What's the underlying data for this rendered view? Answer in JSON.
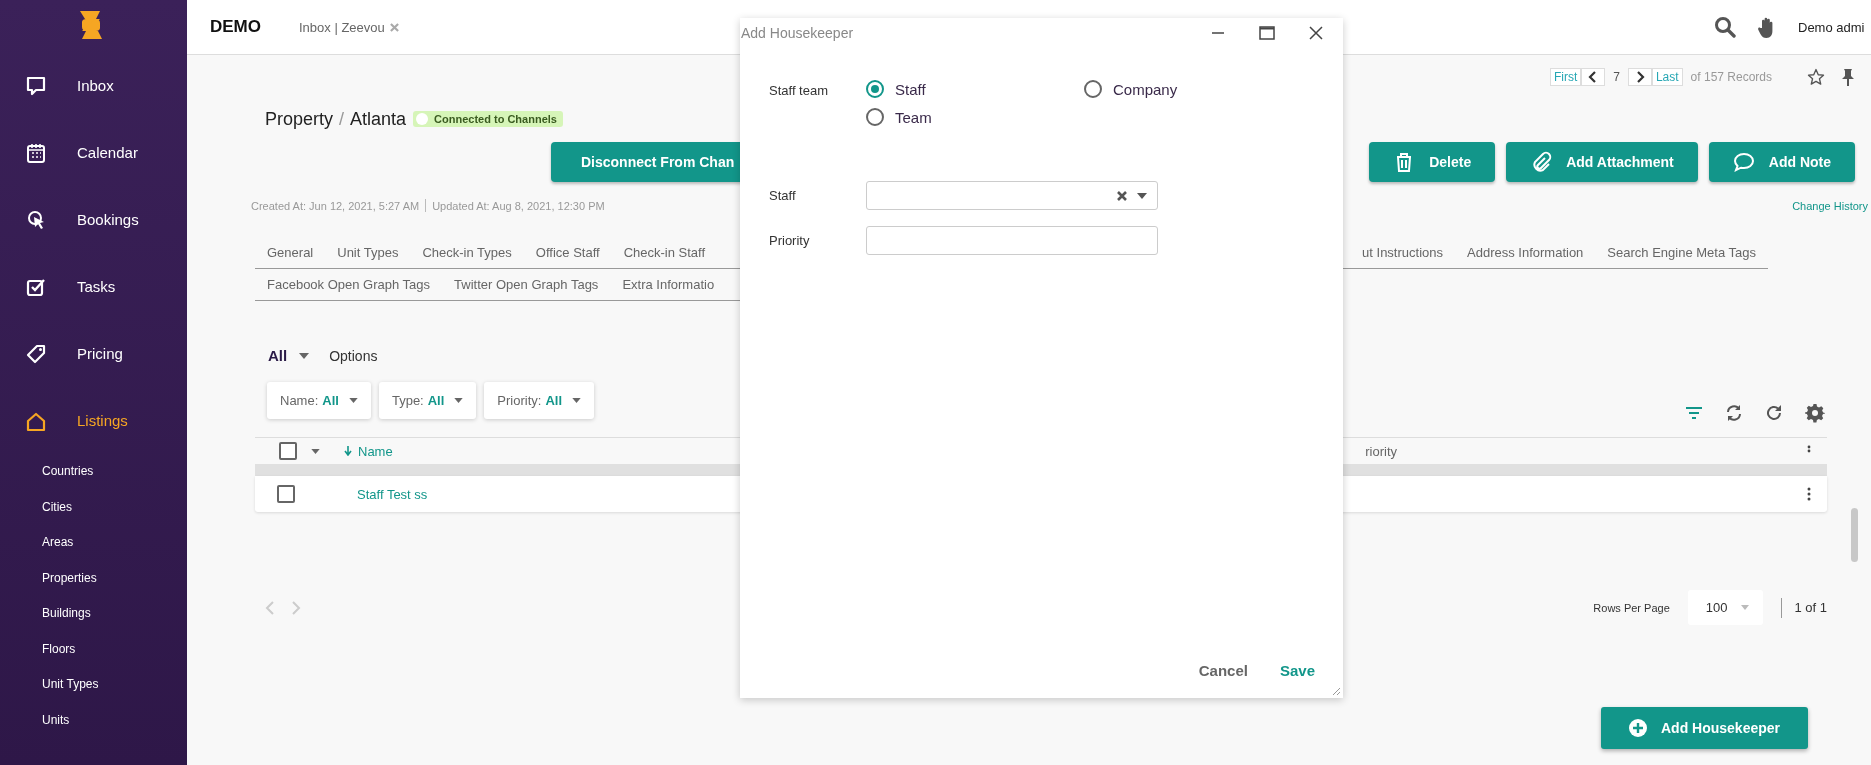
{
  "sidebar": {
    "items": [
      {
        "label": "Inbox",
        "selected": false
      },
      {
        "label": "Calendar",
        "selected": false
      },
      {
        "label": "Bookings",
        "selected": false
      },
      {
        "label": "Tasks",
        "selected": false
      },
      {
        "label": "Pricing",
        "selected": false
      },
      {
        "label": "Listings",
        "selected": true
      }
    ],
    "sub_items": [
      "Countries",
      "Cities",
      "Areas",
      "Properties",
      "Buildings",
      "Floors",
      "Unit Types",
      "Units"
    ]
  },
  "top_bar": {
    "brand": "DEMO",
    "open_tab": "Inbox | Zeevou",
    "user": "Demo admi"
  },
  "record_nav": {
    "first": "First",
    "current": "7",
    "last": "Last",
    "total": "of 157 Records"
  },
  "title": {
    "section": "Property",
    "separator": "/",
    "name": "Atlanta",
    "badge": "Connected to Channels"
  },
  "actions": [
    {
      "label": "Disconnect From Chan"
    },
    {
      "label": "Delete"
    },
    {
      "label": "Add Attachment"
    },
    {
      "label": "Add Note"
    }
  ],
  "meta": {
    "created": "Created At: Jun 12, 2021, 5:27 AM",
    "updated": "Updated At: Aug 8, 2021, 12:30 PM",
    "history_link": "Change History"
  },
  "tabs": {
    "row_1_left": [
      {
        "label": "General",
        "selected": false
      },
      {
        "label": "Unit Types",
        "selected": false
      },
      {
        "label": "Check-in Types",
        "selected": false
      },
      {
        "label": "Office Staff",
        "selected": false
      },
      {
        "label": "Check-in Staff",
        "selected": false
      }
    ],
    "row_1_right": [
      {
        "label": "ut Instructions",
        "selected": false
      },
      {
        "label": "Address Information",
        "selected": false
      },
      {
        "label": "Search Engine Meta Tags",
        "selected": false
      }
    ],
    "row_2": [
      {
        "label": "Facebook Open Graph Tags",
        "selected": false
      },
      {
        "label": "Twitter Open Graph Tags",
        "selected": false
      },
      {
        "label": "Extra Informatio",
        "selected": false
      }
    ]
  },
  "list_view": {
    "scope": "All",
    "options": "Options"
  },
  "filters": [
    {
      "label": "Name:",
      "value": "All"
    },
    {
      "label": "Type:",
      "value": "All"
    },
    {
      "label": "Priority:",
      "value": "All"
    }
  ],
  "table": {
    "header_checked": false,
    "columns": [
      {
        "label": "Name",
        "sorted": true
      },
      {
        "label": "riority",
        "sorted": false
      }
    ],
    "rows": [
      {
        "checked": false,
        "cells": [
          "Staff Test ss"
        ]
      }
    ]
  },
  "pager": {
    "rows_label": "Rows Per Page",
    "rows_value": "100",
    "page": "1 of 1"
  },
  "add_button": "Add Housekeeper",
  "dialog": {
    "title": "Add Housekeeper",
    "team_label": "Staff team",
    "options": [
      {
        "label": "Staff",
        "selected": true
      },
      {
        "label": "Company",
        "selected": false
      },
      {
        "label": "Team",
        "selected": false
      }
    ],
    "staff_label": "Staff",
    "priority_label": "Priority",
    "cancel": "Cancel",
    "save": "Save"
  }
}
